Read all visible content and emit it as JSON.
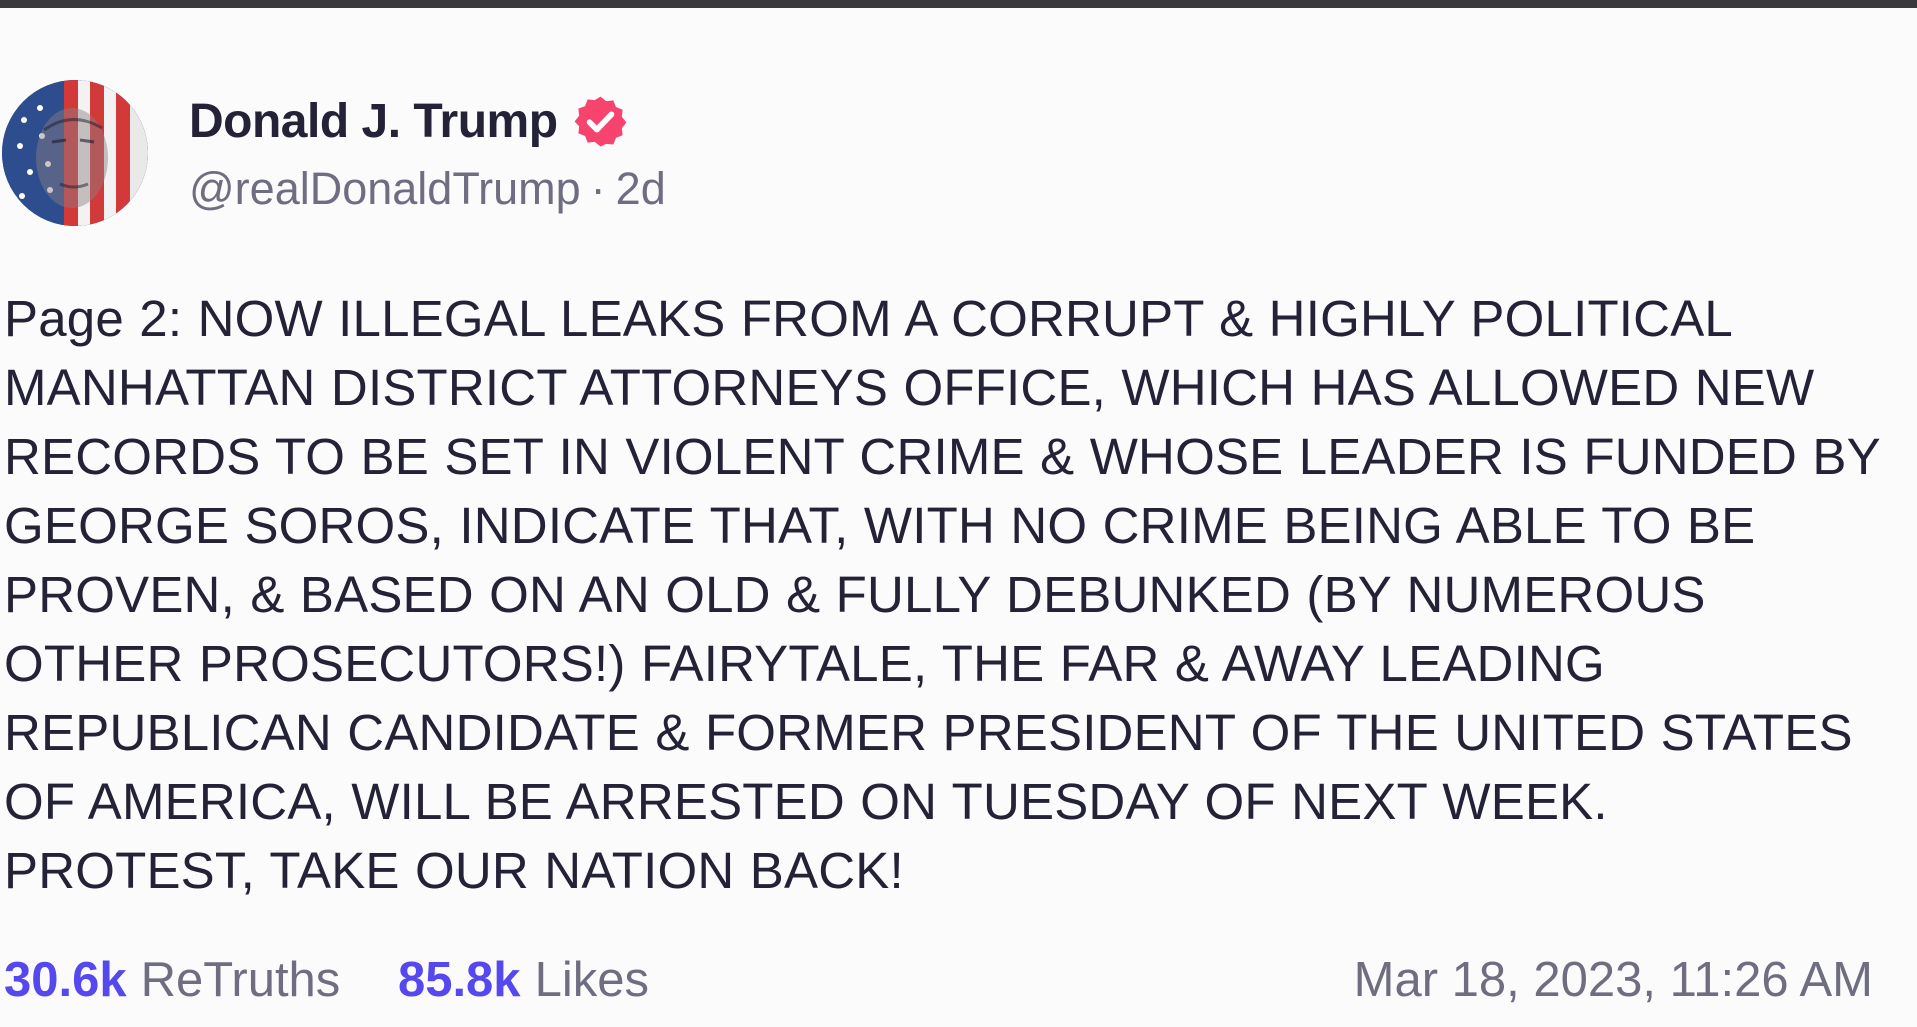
{
  "post": {
    "author": {
      "display_name": "Donald J. Trump",
      "handle": "@realDonaldTrump",
      "age": "2d",
      "verified_icon": "verified-badge-icon",
      "avatar": "profile-avatar"
    },
    "lines": [
      "Page 2: NOW ILLEGAL LEAKS FROM A CORRUPT & HIGHLY POLITICAL",
      "MANHATTAN DISTRICT ATTORNEYS OFFICE, WHICH HAS ALLOWED NEW",
      "RECORDS TO BE SET IN VIOLENT CRIME & WHOSE LEADER IS FUNDED BY",
      "GEORGE SOROS, INDICATE THAT, WITH NO CRIME BEING ABLE TO BE",
      "PROVEN, & BASED ON AN OLD & FULLY DEBUNKED (BY NUMEROUS",
      "OTHER PROSECUTORS!) FAIRYTALE, THE FAR & AWAY LEADING",
      "REPUBLICAN CANDIDATE & FORMER PRESIDENT OF THE UNITED STATES",
      "OF AMERICA, WILL BE ARRESTED ON TUESDAY OF NEXT WEEK.",
      "PROTEST, TAKE OUR NATION BACK!"
    ],
    "stats": {
      "retruths_count": "30.6k",
      "retruths_label": "ReTruths",
      "likes_count": "85.8k",
      "likes_label": "Likes"
    },
    "timestamp": "Mar 18, 2023, 11:26 AM"
  },
  "colors": {
    "accent": "#5448ee",
    "verified_badge": "#f6446f",
    "text_primary": "#232236",
    "text_secondary": "#6f6e81",
    "background": "#fbfbfc"
  }
}
